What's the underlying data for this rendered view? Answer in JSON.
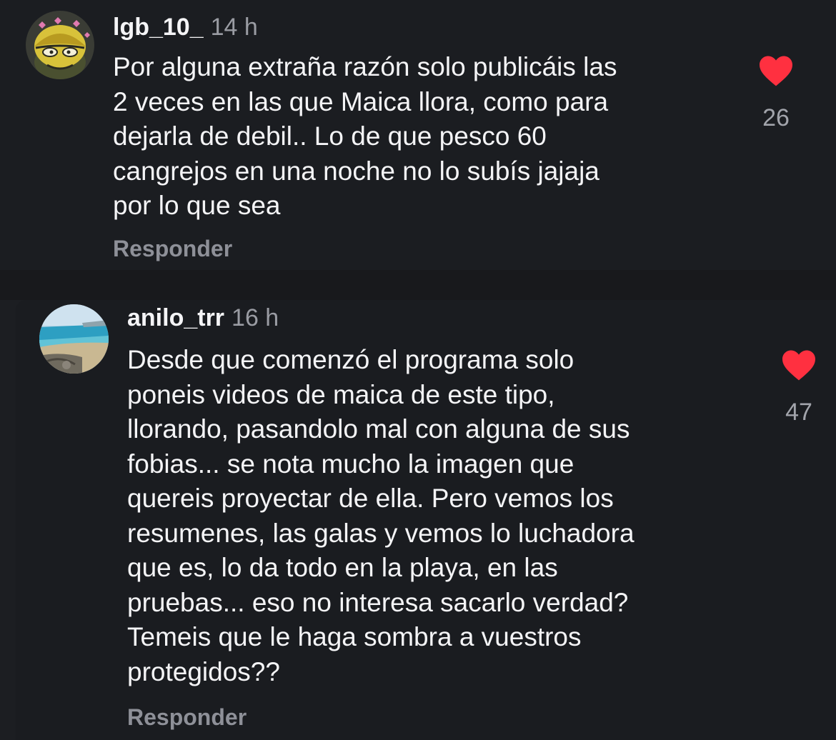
{
  "comments": [
    {
      "username": "lgb_10_",
      "time": "14 h",
      "text": "Por alguna extraña razón solo publicáis las\n2 veces en las que Maica llora, como para\ndejarla de debil.. Lo de que pesco 60\ncangrejos en una noche no lo subís jajaja\npor lo que sea",
      "reply_label": "Responder",
      "likes": "26",
      "liked": true,
      "avatar_icon": "cartoon-character-avatar"
    },
    {
      "username": "anilo_trr",
      "time": "16 h",
      "text": "Desde que comenzó el programa solo\nponeis videos de maica de este tipo,\nllorando, pasandolo mal con alguna de sus\nfobias... se nota mucho la imagen que\nquereis proyectar de ella. Pero vemos los\nresumenes, las galas y vemos lo luchadora\nque es, lo da todo en la playa, en las\npruebas... eso no interesa sacarlo verdad?\nTemeis que le haga sombra a vuestros\nprotegidos??",
      "reply_label": "Responder",
      "likes": "47",
      "liked": true,
      "avatar_icon": "beach-photo-avatar"
    }
  ],
  "colors": {
    "background": "#1c1e22",
    "heart": "#ff3040",
    "secondary_text": "#9a9ca3"
  }
}
